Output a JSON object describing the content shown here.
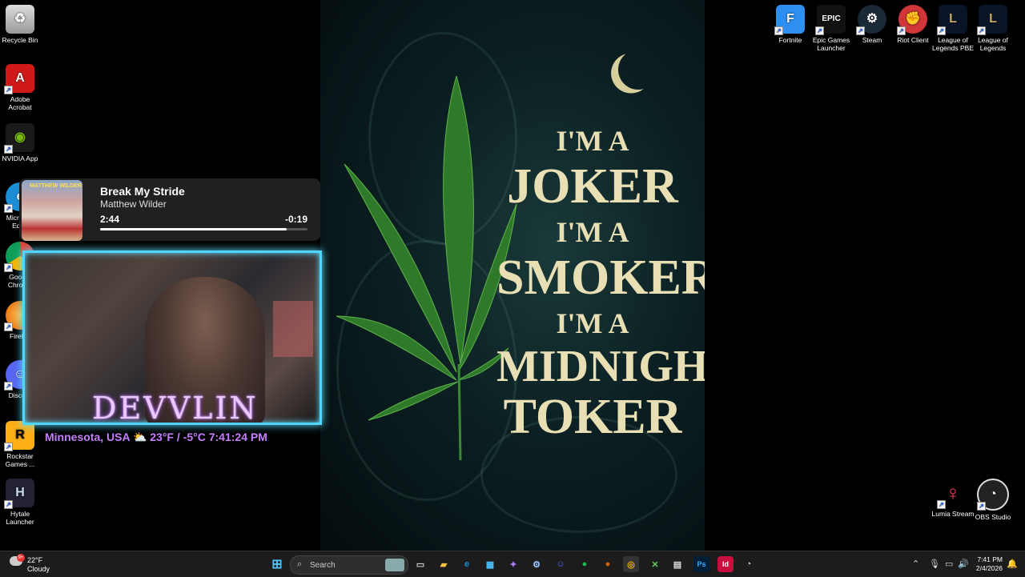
{
  "desktop_left": [
    {
      "label": "Recycle Bin",
      "icon": "recycle-bin-icon"
    },
    {
      "label": "Adobe Acrobat",
      "icon": "adobe-acrobat-icon"
    },
    {
      "label": "NVIDIA App",
      "icon": "nvidia-icon"
    },
    {
      "label": "Microsoft Edge",
      "icon": "edge-icon"
    },
    {
      "label": "Google Chrome",
      "icon": "chrome-icon"
    },
    {
      "label": "Firefox",
      "icon": "firefox-icon"
    },
    {
      "label": "Discord",
      "icon": "discord-icon"
    },
    {
      "label": "Rockstar Games ...",
      "icon": "rockstar-icon"
    },
    {
      "label": "Hytale Launcher",
      "icon": "hytale-icon"
    }
  ],
  "desktop_right": [
    {
      "label": "Fortnite",
      "icon": "fortnite-icon"
    },
    {
      "label": "Epic Games Launcher",
      "icon": "epic-games-icon"
    },
    {
      "label": "Steam",
      "icon": "steam-icon"
    },
    {
      "label": "Riot Client",
      "icon": "riot-client-icon"
    },
    {
      "label": "League of Legends PBE",
      "icon": "league-pbe-icon"
    },
    {
      "label": "League of Legends",
      "icon": "league-icon"
    }
  ],
  "desktop_bottom_right": [
    {
      "label": "Lumia Stream",
      "icon": "lumia-stream-icon"
    },
    {
      "label": "OBS Studio",
      "icon": "obs-studio-icon"
    }
  ],
  "wallpaper": {
    "lines": [
      "I'M A",
      "JOKER",
      "I'M A",
      "SMOKER",
      "I'M A",
      "MIDNIGHT",
      "TOKER"
    ]
  },
  "media": {
    "title": "Break My Stride",
    "artist": "Matthew Wilder",
    "elapsed": "2:44",
    "remaining": "-0:19",
    "progress": 0.9
  },
  "overlay": {
    "name": "DEVVLIN",
    "location": "Minnesota, USA",
    "temp": "23°F / -5°C",
    "time": "7:41:24 PM"
  },
  "taskbar": {
    "weather_temp": "22°F",
    "weather_desc": "Cloudy",
    "weather_badge": "9+",
    "search_placeholder": "Search",
    "clock_time": "7:41 PM",
    "clock_date": "2/4/2026"
  },
  "colors": {
    "accent": "#4fd5ff",
    "overlay_text": "#c77dff",
    "wallpaper_text": "#e9dfb5"
  }
}
